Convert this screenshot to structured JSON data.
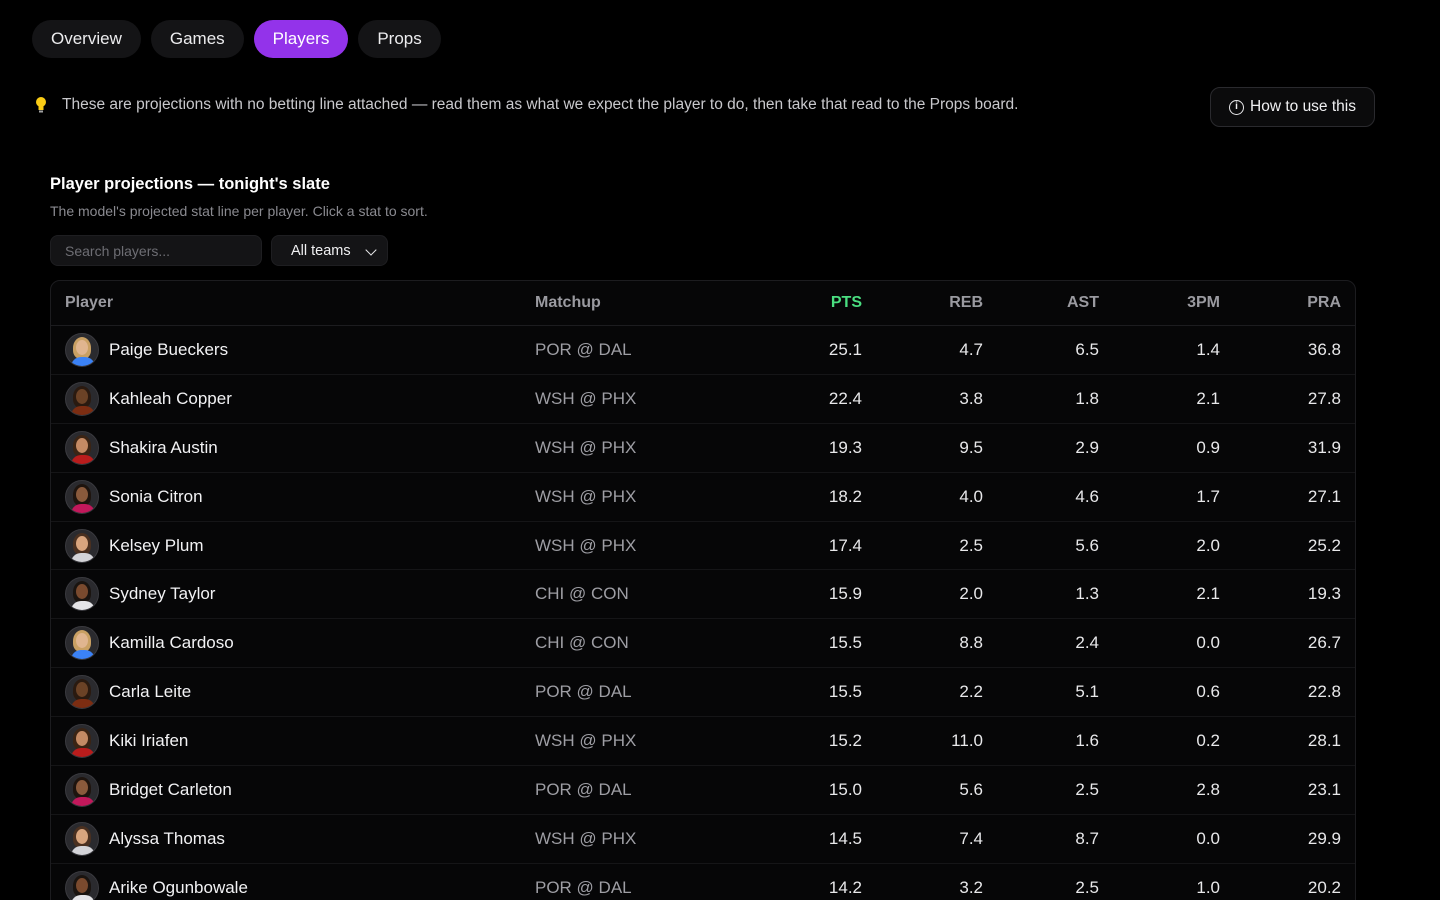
{
  "tabs": [
    {
      "label": "Overview",
      "active": false
    },
    {
      "label": "Games",
      "active": false
    },
    {
      "label": "Players",
      "active": true
    },
    {
      "label": "Props",
      "active": false
    }
  ],
  "notice": {
    "icon": "lightbulb-icon",
    "text": "These are projections with no betting line attached — read them as what we expect the player to do, then take that read to the Props board."
  },
  "howto": {
    "label": "How to use this",
    "icon": "info-icon"
  },
  "section": {
    "title": "Player projections — tonight's slate",
    "subtitle": "The model's projected stat line per player. Click a stat to sort."
  },
  "search": {
    "placeholder": "Search players...",
    "value": ""
  },
  "team_filter": {
    "selected": "All teams"
  },
  "table": {
    "columns": {
      "player": "Player",
      "matchup": "Matchup",
      "pts": "PTS",
      "reb": "REB",
      "ast": "AST",
      "tpm": "3PM",
      "pra": "PRA"
    },
    "sorted_by": "PTS",
    "accent_color": "#4ade80",
    "rows": [
      {
        "name": "Paige Bueckers",
        "matchup": "POR @ DAL",
        "pts": "25.1",
        "reb": "4.7",
        "ast": "6.5",
        "tpm": "1.4",
        "pra": "36.8"
      },
      {
        "name": "Kahleah Copper",
        "matchup": "WSH @ PHX",
        "pts": "22.4",
        "reb": "3.8",
        "ast": "1.8",
        "tpm": "2.1",
        "pra": "27.8"
      },
      {
        "name": "Shakira Austin",
        "matchup": "WSH @ PHX",
        "pts": "19.3",
        "reb": "9.5",
        "ast": "2.9",
        "tpm": "0.9",
        "pra": "31.9"
      },
      {
        "name": "Sonia Citron",
        "matchup": "WSH @ PHX",
        "pts": "18.2",
        "reb": "4.0",
        "ast": "4.6",
        "tpm": "1.7",
        "pra": "27.1"
      },
      {
        "name": "Kelsey Plum",
        "matchup": "WSH @ PHX",
        "pts": "17.4",
        "reb": "2.5",
        "ast": "5.6",
        "tpm": "2.0",
        "pra": "25.2"
      },
      {
        "name": "Sydney Taylor",
        "matchup": "CHI @ CON",
        "pts": "15.9",
        "reb": "2.0",
        "ast": "1.3",
        "tpm": "2.1",
        "pra": "19.3"
      },
      {
        "name": "Kamilla Cardoso",
        "matchup": "CHI @ CON",
        "pts": "15.5",
        "reb": "8.8",
        "ast": "2.4",
        "tpm": "0.0",
        "pra": "26.7"
      },
      {
        "name": "Carla Leite",
        "matchup": "POR @ DAL",
        "pts": "15.5",
        "reb": "2.2",
        "ast": "5.1",
        "tpm": "0.6",
        "pra": "22.8"
      },
      {
        "name": "Kiki Iriafen",
        "matchup": "WSH @ PHX",
        "pts": "15.2",
        "reb": "11.0",
        "ast": "1.6",
        "tpm": "0.2",
        "pra": "28.1"
      },
      {
        "name": "Bridget Carleton",
        "matchup": "POR @ DAL",
        "pts": "15.0",
        "reb": "5.6",
        "ast": "2.5",
        "tpm": "2.8",
        "pra": "23.1"
      },
      {
        "name": "Alyssa Thomas",
        "matchup": "WSH @ PHX",
        "pts": "14.5",
        "reb": "7.4",
        "ast": "8.7",
        "tpm": "0.0",
        "pra": "29.9"
      },
      {
        "name": "Arike Ogunbowale",
        "matchup": "POR @ DAL",
        "pts": "14.2",
        "reb": "3.2",
        "ast": "2.5",
        "tpm": "1.0",
        "pra": "20.2"
      }
    ]
  }
}
